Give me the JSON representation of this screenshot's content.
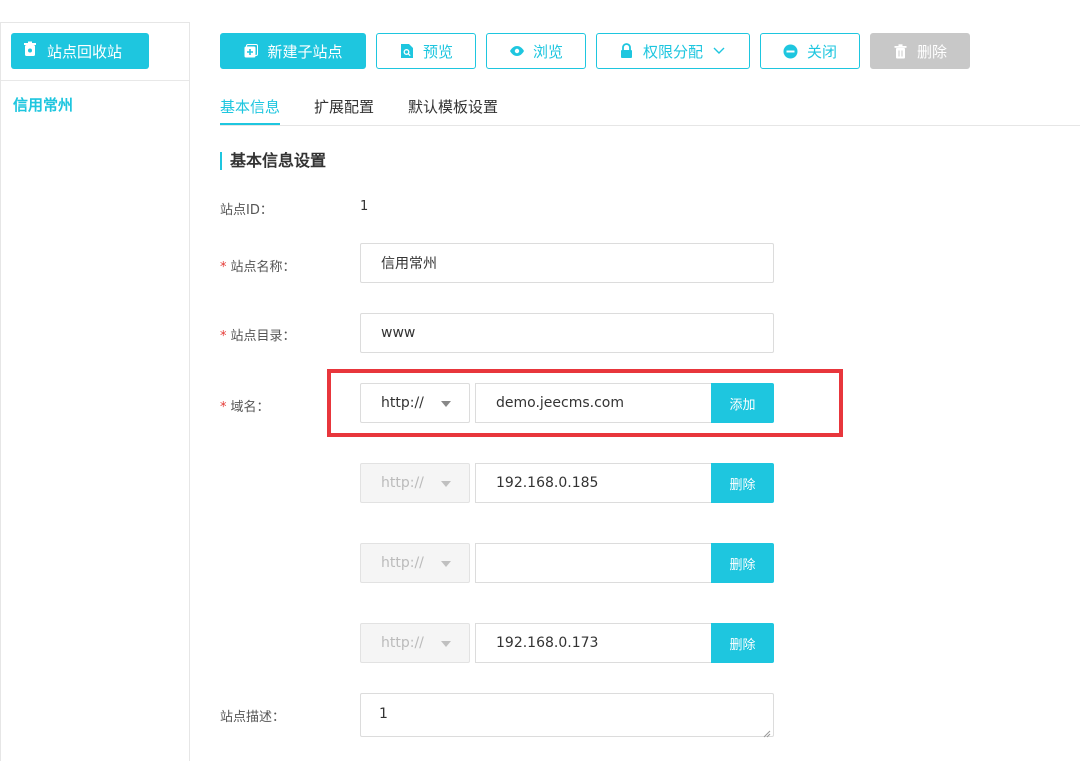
{
  "sidebar": {
    "recycle_label": "站点回收站",
    "site_name": "信用常州"
  },
  "toolbar": {
    "new_child_site": "新建子站点",
    "preview": "预览",
    "browse": "浏览",
    "permissions": "权限分配",
    "close": "关闭",
    "delete": "删除"
  },
  "tabs": [
    "基本信息",
    "扩展配置",
    "默认模板设置"
  ],
  "section_title": "基本信息设置",
  "form": {
    "site_id_label": "站点ID：",
    "site_id_value": "1",
    "site_name_label": "站点名称：",
    "site_name_value": "信用常州",
    "site_dir_label": "站点目录：",
    "site_dir_value": "www",
    "domain_label": "域名：",
    "protocol": "http://",
    "domains": [
      {
        "protocol": "http://",
        "value": "demo.jeecms.com",
        "action": "添加"
      },
      {
        "protocol": "http://",
        "value": "192.168.0.185",
        "action": "删除"
      },
      {
        "protocol": "http://",
        "value": "",
        "action": "删除"
      },
      {
        "protocol": "http://",
        "value": "192.168.0.173",
        "action": "删除"
      }
    ],
    "desc_label": "站点描述：",
    "desc_value": "1"
  },
  "colors": {
    "accent": "#1ec6df",
    "highlight": "#e8363c",
    "required": "#e53935"
  }
}
